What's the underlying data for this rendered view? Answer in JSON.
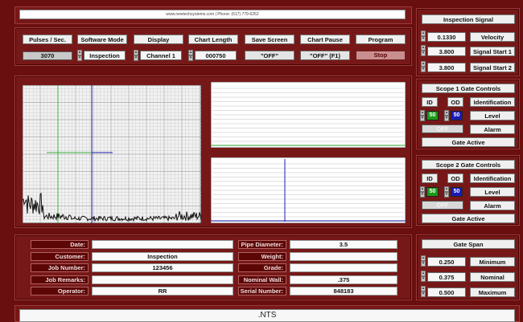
{
  "header": {
    "url_text": "www.newtechsystems.com | Phone: (617) 779-6262"
  },
  "controls": {
    "pulses": {
      "label": "Pulses / Sec.",
      "value": "3070"
    },
    "software_mode": {
      "label": "Software Mode",
      "value": "Inspection"
    },
    "display": {
      "label": "Display",
      "value": "Channel 1"
    },
    "chart_length": {
      "label": "Chart Length",
      "value": "000750"
    },
    "save_screen": {
      "label": "Save Screen",
      "value": "\"OFF\""
    },
    "chart_pause": {
      "label": "Chart Pause",
      "value": "\"OFF\" (F1)"
    },
    "program": {
      "label": "Program",
      "value": "Stop"
    }
  },
  "inspection_signal": {
    "title": "Inspection Signal",
    "rows": [
      {
        "value": "0.1330",
        "label": "Velocity"
      },
      {
        "value": "3.800",
        "label": "Signal Start 1"
      },
      {
        "value": "3.800",
        "label": "Signal Start 2"
      }
    ]
  },
  "scope1": {
    "title": "Scope 1 Gate Controls",
    "id_label": "ID",
    "od_label": "OD",
    "identification": "Identification",
    "id_level": "50",
    "od_level": "50",
    "level_label": "Level",
    "alarm_toggle": "OFF",
    "alarm_label": "Alarm",
    "gate_active": "Gate Active"
  },
  "scope2": {
    "title": "Scope 2 Gate Controls",
    "id_label": "ID",
    "od_label": "OD",
    "identification": "Identification",
    "id_level": "50",
    "od_level": "50",
    "level_label": "Level",
    "alarm_toggle": "OFF",
    "alarm_label": "Alarm",
    "gate_active": "Gate Active"
  },
  "job_info": {
    "rows_left": [
      {
        "label": "Date:",
        "value": ""
      },
      {
        "label": "Customer:",
        "value": "Inspection"
      },
      {
        "label": "Job Number:",
        "value": "123456"
      },
      {
        "label": "Job Remarks:",
        "value": ""
      },
      {
        "label": "Operator:",
        "value": "RR"
      }
    ],
    "rows_right": [
      {
        "label": "Pipe Diameter:",
        "value": "3.5"
      },
      {
        "label": "Weight:",
        "value": ""
      },
      {
        "label": "Grade:",
        "value": ""
      },
      {
        "label": "Nominal Wall:",
        "value": ".375"
      },
      {
        "label": "Serial Number:",
        "value": "848183"
      }
    ]
  },
  "gate_span": {
    "title": "Gate Span",
    "rows": [
      {
        "value": "0.250",
        "label": "Minimum"
      },
      {
        "value": "0.375",
        "label": "Nominal"
      },
      {
        "value": "0.500",
        "label": "Maximum"
      }
    ]
  },
  "footer": {
    "text": ".NTS"
  },
  "colors": {
    "gate_id": "#1a9a1a",
    "gate_od": "#1a1ab8",
    "trace_green": "#3cb43c",
    "trace_blue": "#1c1cb0"
  }
}
